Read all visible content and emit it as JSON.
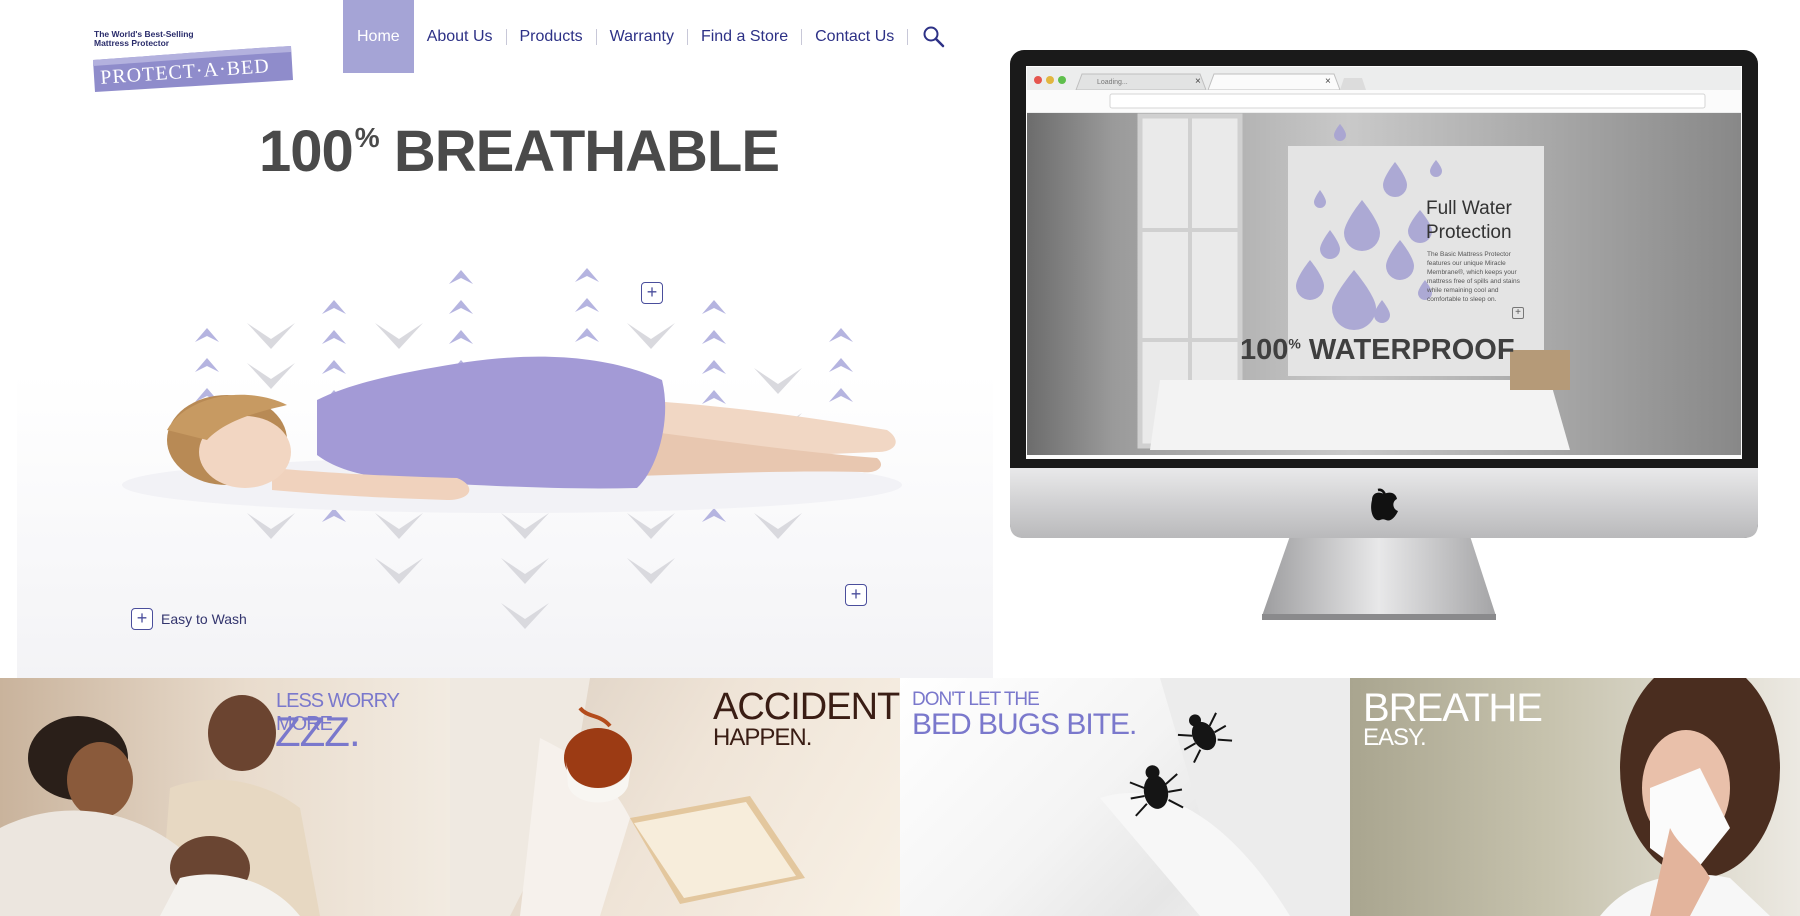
{
  "brand": {
    "tagline": "The World's Best-Selling Mattress Protector",
    "name": "PROTECT·A·BED",
    "colors": {
      "accent": "#a5a4d6",
      "navText": "#2d3186",
      "headline": "#4a4a4a"
    }
  },
  "nav": {
    "items": [
      {
        "label": "Home",
        "active": true
      },
      {
        "label": "About Us"
      },
      {
        "label": "Products"
      },
      {
        "label": "Warranty"
      },
      {
        "label": "Find a Store"
      },
      {
        "label": "Contact Us"
      }
    ],
    "search_icon": "search-icon"
  },
  "hero": {
    "headline_number": "100",
    "headline_sup": "%",
    "headline_word": "BREATHABLE",
    "hotspot_symbol": "+",
    "easy_wash": "Easy to Wash"
  },
  "browser": {
    "tab1": "Loading...",
    "close1": "×",
    "close2": "×",
    "overlay_title_1": "Full Water",
    "overlay_title_2": "Protection",
    "overlay_body": "The Basic Mattress Protector features our unique Miracle Membrane®, which keeps your mattress free of spills and stains while remaining cool and comfortable to sleep on.",
    "waterproof_number": "100",
    "waterproof_sup": "%",
    "waterproof_word": "WATERPROOF",
    "hotspot_symbol": "+"
  },
  "panels": [
    {
      "line1": "LESS WORRY MORE",
      "line2": "ZZZ."
    },
    {
      "line1": "ACCIDENTS",
      "line2": "HAPPEN."
    },
    {
      "line1": "DON'T LET THE",
      "line2": "BED BUGS BITE."
    },
    {
      "line1": "BREATHE",
      "line2": "EASY."
    }
  ]
}
